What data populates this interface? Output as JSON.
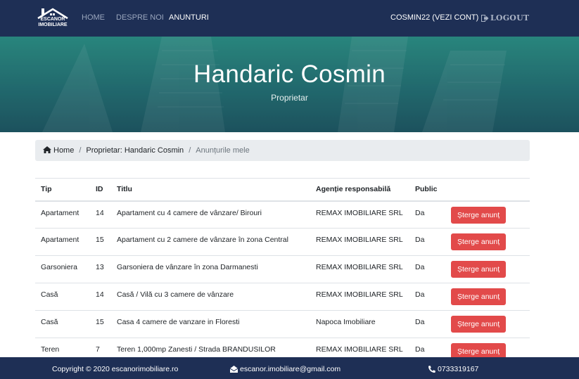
{
  "nav": {
    "logo_line1": "ESCANOR",
    "logo_line2": "IMOBILIARE",
    "links": [
      "HOME",
      "DESPRE NOI",
      "ANUNTURI"
    ],
    "account": "COSMIN22 (VEZI CONT)",
    "logout": "LOGOUT",
    "brand_color": "#1e2f55"
  },
  "hero": {
    "title": "Handaric Cosmin",
    "subtitle": "Proprietar"
  },
  "breadcrumb": {
    "home": "Home",
    "owner": "Proprietar: Handaric Cosmin",
    "current": "Anunțurile mele"
  },
  "table": {
    "headers": [
      "Tip",
      "ID",
      "Titlu",
      "Agenție responsabilă",
      "Public"
    ],
    "delete_label": "Șterge anunț",
    "rows": [
      {
        "tip": "Apartament",
        "id": "14",
        "titlu": "Apartament cu 4 camere de vânzare/ Birouri",
        "agentie": "REMAX IMOBILIARE SRL",
        "public": "Da"
      },
      {
        "tip": "Apartament",
        "id": "15",
        "titlu": "Apartament cu 2 camere de vânzare în zona Central",
        "agentie": "REMAX IMOBILIARE SRL",
        "public": "Da"
      },
      {
        "tip": "Garsoniera",
        "id": "13",
        "titlu": "Garsoniera de vânzare în zona Darmanesti",
        "agentie": "REMAX IMOBILIARE SRL",
        "public": "Da"
      },
      {
        "tip": "Casă",
        "id": "14",
        "titlu": "Casă / Vilă cu 3 camere de vânzare",
        "agentie": "REMAX IMOBILIARE SRL",
        "public": "Da"
      },
      {
        "tip": "Casă",
        "id": "15",
        "titlu": "Casa 4 camere de vanzare in Floresti",
        "agentie": "Napoca Imobiliare",
        "public": "Da"
      },
      {
        "tip": "Teren",
        "id": "7",
        "titlu": "Teren 1,000mp Zanesti / Strada BRANDUSILOR",
        "agentie": "REMAX IMOBILIARE SRL",
        "public": "Da"
      }
    ],
    "delete_color": "#e24a4a"
  },
  "footer": {
    "copyright": "Copyright © 2020 escanorimobiliare.ro",
    "email": "escanor.imobiliare@gmail.com",
    "phone": "0733319167"
  }
}
